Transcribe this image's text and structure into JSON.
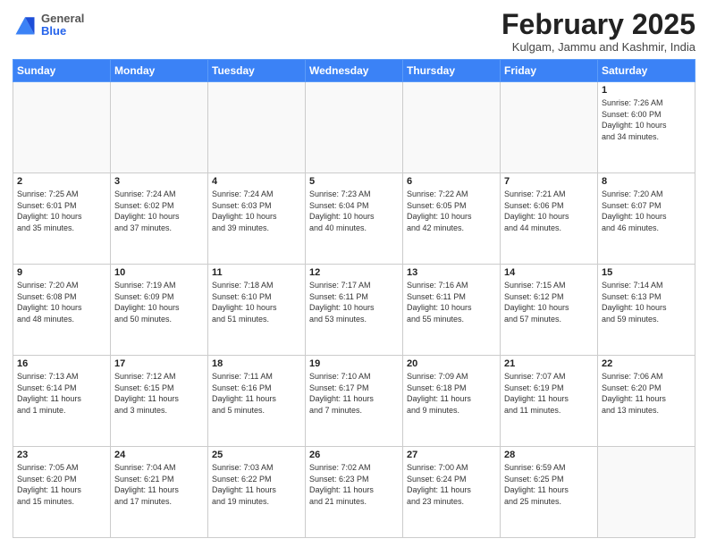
{
  "header": {
    "logo": {
      "general": "General",
      "blue": "Blue"
    },
    "title": "February 2025",
    "location": "Kulgam, Jammu and Kashmir, India"
  },
  "weekdays": [
    "Sunday",
    "Monday",
    "Tuesday",
    "Wednesday",
    "Thursday",
    "Friday",
    "Saturday"
  ],
  "weeks": [
    [
      {
        "day": "",
        "info": ""
      },
      {
        "day": "",
        "info": ""
      },
      {
        "day": "",
        "info": ""
      },
      {
        "day": "",
        "info": ""
      },
      {
        "day": "",
        "info": ""
      },
      {
        "day": "",
        "info": ""
      },
      {
        "day": "1",
        "info": "Sunrise: 7:26 AM\nSunset: 6:00 PM\nDaylight: 10 hours\nand 34 minutes."
      }
    ],
    [
      {
        "day": "2",
        "info": "Sunrise: 7:25 AM\nSunset: 6:01 PM\nDaylight: 10 hours\nand 35 minutes."
      },
      {
        "day": "3",
        "info": "Sunrise: 7:24 AM\nSunset: 6:02 PM\nDaylight: 10 hours\nand 37 minutes."
      },
      {
        "day": "4",
        "info": "Sunrise: 7:24 AM\nSunset: 6:03 PM\nDaylight: 10 hours\nand 39 minutes."
      },
      {
        "day": "5",
        "info": "Sunrise: 7:23 AM\nSunset: 6:04 PM\nDaylight: 10 hours\nand 40 minutes."
      },
      {
        "day": "6",
        "info": "Sunrise: 7:22 AM\nSunset: 6:05 PM\nDaylight: 10 hours\nand 42 minutes."
      },
      {
        "day": "7",
        "info": "Sunrise: 7:21 AM\nSunset: 6:06 PM\nDaylight: 10 hours\nand 44 minutes."
      },
      {
        "day": "8",
        "info": "Sunrise: 7:20 AM\nSunset: 6:07 PM\nDaylight: 10 hours\nand 46 minutes."
      }
    ],
    [
      {
        "day": "9",
        "info": "Sunrise: 7:20 AM\nSunset: 6:08 PM\nDaylight: 10 hours\nand 48 minutes."
      },
      {
        "day": "10",
        "info": "Sunrise: 7:19 AM\nSunset: 6:09 PM\nDaylight: 10 hours\nand 50 minutes."
      },
      {
        "day": "11",
        "info": "Sunrise: 7:18 AM\nSunset: 6:10 PM\nDaylight: 10 hours\nand 51 minutes."
      },
      {
        "day": "12",
        "info": "Sunrise: 7:17 AM\nSunset: 6:11 PM\nDaylight: 10 hours\nand 53 minutes."
      },
      {
        "day": "13",
        "info": "Sunrise: 7:16 AM\nSunset: 6:11 PM\nDaylight: 10 hours\nand 55 minutes."
      },
      {
        "day": "14",
        "info": "Sunrise: 7:15 AM\nSunset: 6:12 PM\nDaylight: 10 hours\nand 57 minutes."
      },
      {
        "day": "15",
        "info": "Sunrise: 7:14 AM\nSunset: 6:13 PM\nDaylight: 10 hours\nand 59 minutes."
      }
    ],
    [
      {
        "day": "16",
        "info": "Sunrise: 7:13 AM\nSunset: 6:14 PM\nDaylight: 11 hours\nand 1 minute."
      },
      {
        "day": "17",
        "info": "Sunrise: 7:12 AM\nSunset: 6:15 PM\nDaylight: 11 hours\nand 3 minutes."
      },
      {
        "day": "18",
        "info": "Sunrise: 7:11 AM\nSunset: 6:16 PM\nDaylight: 11 hours\nand 5 minutes."
      },
      {
        "day": "19",
        "info": "Sunrise: 7:10 AM\nSunset: 6:17 PM\nDaylight: 11 hours\nand 7 minutes."
      },
      {
        "day": "20",
        "info": "Sunrise: 7:09 AM\nSunset: 6:18 PM\nDaylight: 11 hours\nand 9 minutes."
      },
      {
        "day": "21",
        "info": "Sunrise: 7:07 AM\nSunset: 6:19 PM\nDaylight: 11 hours\nand 11 minutes."
      },
      {
        "day": "22",
        "info": "Sunrise: 7:06 AM\nSunset: 6:20 PM\nDaylight: 11 hours\nand 13 minutes."
      }
    ],
    [
      {
        "day": "23",
        "info": "Sunrise: 7:05 AM\nSunset: 6:20 PM\nDaylight: 11 hours\nand 15 minutes."
      },
      {
        "day": "24",
        "info": "Sunrise: 7:04 AM\nSunset: 6:21 PM\nDaylight: 11 hours\nand 17 minutes."
      },
      {
        "day": "25",
        "info": "Sunrise: 7:03 AM\nSunset: 6:22 PM\nDaylight: 11 hours\nand 19 minutes."
      },
      {
        "day": "26",
        "info": "Sunrise: 7:02 AM\nSunset: 6:23 PM\nDaylight: 11 hours\nand 21 minutes."
      },
      {
        "day": "27",
        "info": "Sunrise: 7:00 AM\nSunset: 6:24 PM\nDaylight: 11 hours\nand 23 minutes."
      },
      {
        "day": "28",
        "info": "Sunrise: 6:59 AM\nSunset: 6:25 PM\nDaylight: 11 hours\nand 25 minutes."
      },
      {
        "day": "",
        "info": ""
      }
    ]
  ]
}
